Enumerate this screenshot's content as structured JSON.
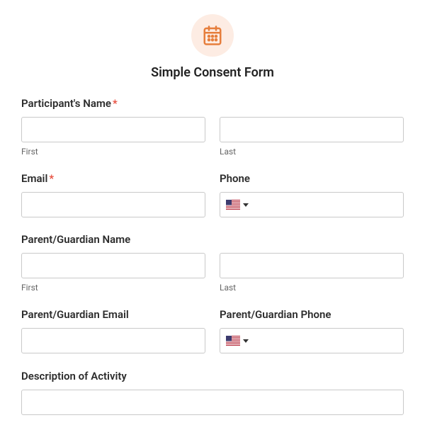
{
  "form": {
    "title": "Simple Consent Form",
    "icon": "calendar-icon"
  },
  "fields": {
    "participant_name": {
      "label": "Participant's Name",
      "required": true,
      "first_sublabel": "First",
      "last_sublabel": "Last"
    },
    "email": {
      "label": "Email",
      "required": true
    },
    "phone": {
      "label": "Phone",
      "country": "US"
    },
    "guardian_name": {
      "label": "Parent/Guardian Name",
      "first_sublabel": "First",
      "last_sublabel": "Last"
    },
    "guardian_email": {
      "label": "Parent/Guardian Email"
    },
    "guardian_phone": {
      "label": "Parent/Guardian Phone",
      "country": "US"
    },
    "description": {
      "label": "Description of Activity"
    }
  }
}
